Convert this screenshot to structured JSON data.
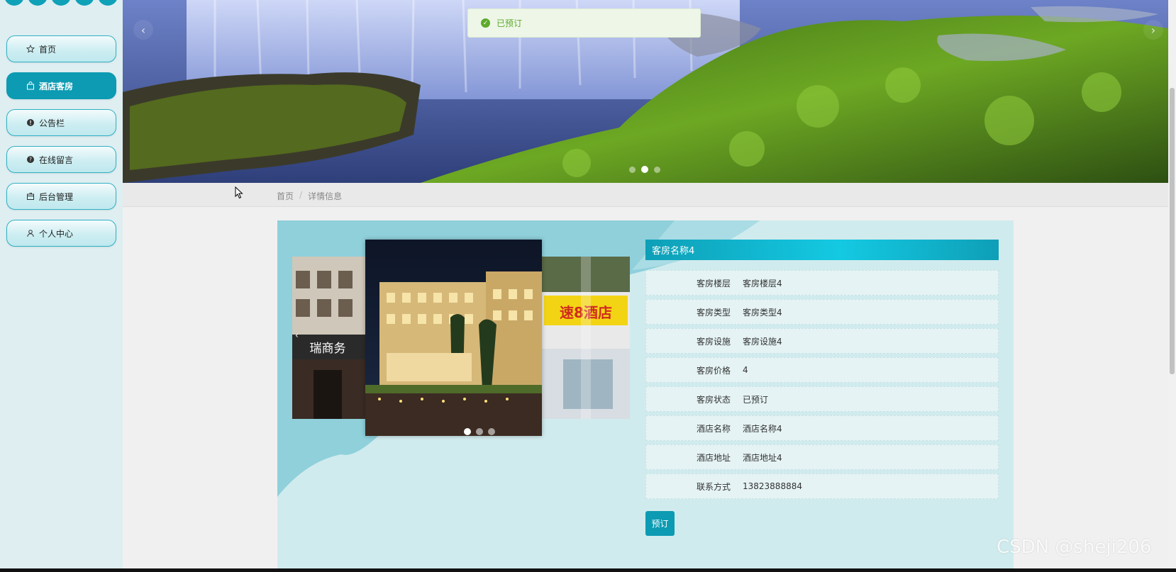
{
  "sidebar": {
    "items": [
      {
        "label": "首页",
        "icon": "star-icon"
      },
      {
        "label": "酒店客房",
        "icon": "bag-icon",
        "active": true
      },
      {
        "label": "公告栏",
        "icon": "info-icon"
      },
      {
        "label": "在线留言",
        "icon": "help-icon"
      },
      {
        "label": "后台管理",
        "icon": "box-icon"
      },
      {
        "label": "个人中心",
        "icon": "user-icon"
      }
    ]
  },
  "toast": {
    "message": "已预订",
    "status": "success"
  },
  "banner": {
    "active_slide": 2,
    "slide_count": 3
  },
  "breadcrumb": {
    "home": "首页",
    "separator": "/",
    "current": "详情信息"
  },
  "detail": {
    "title": "客房名称4",
    "fields": [
      {
        "label": "客房楼层",
        "value": "客房楼层4"
      },
      {
        "label": "客房类型",
        "value": "客房类型4"
      },
      {
        "label": "客房设施",
        "value": "客房设施4"
      },
      {
        "label": "客房价格",
        "value": "4"
      },
      {
        "label": "客房状态",
        "value": "已预订"
      },
      {
        "label": "酒店名称",
        "value": "酒店名称4"
      },
      {
        "label": "酒店地址",
        "value": "酒店地址4"
      },
      {
        "label": "联系方式",
        "value": "13823888884"
      }
    ],
    "book_label": "预订"
  },
  "gallery": {
    "left_sign": "瑞商务",
    "right_sign": "速8酒店",
    "active_slide": 1,
    "slide_count": 3
  },
  "watermark": "CSDN @sheji206",
  "colors": {
    "accent": "#0c9bb3",
    "success": "#5daa2a",
    "sidebar_bg": "#deeef1"
  }
}
